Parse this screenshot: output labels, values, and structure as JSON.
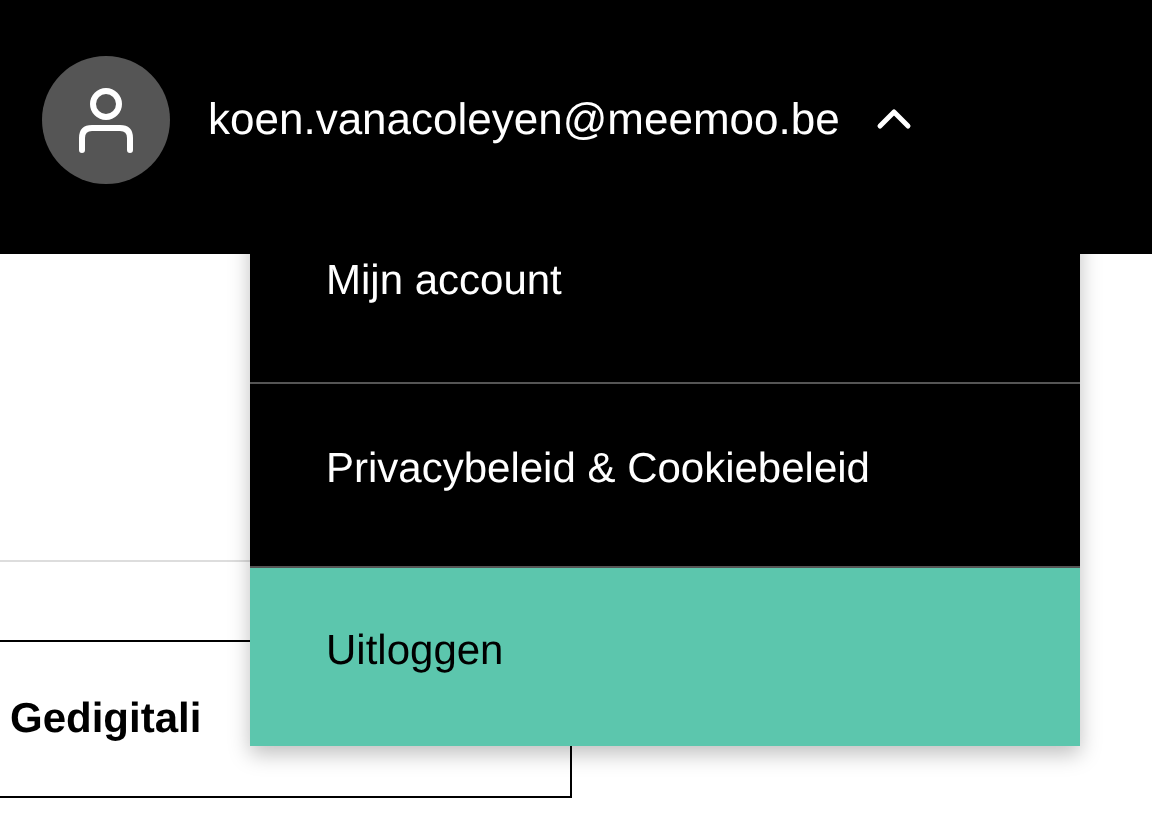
{
  "header": {
    "user_email": "koen.vanacoleyen@meemoo.be",
    "menu_expanded": true
  },
  "user_menu": {
    "items": [
      {
        "label": "Mijn account",
        "selected": false
      },
      {
        "label": "Privacybeleid & Cookiebeleid",
        "selected": false
      },
      {
        "label": "Uitloggen",
        "selected": true
      }
    ]
  },
  "content": {
    "card_title": "Gedigitali"
  }
}
